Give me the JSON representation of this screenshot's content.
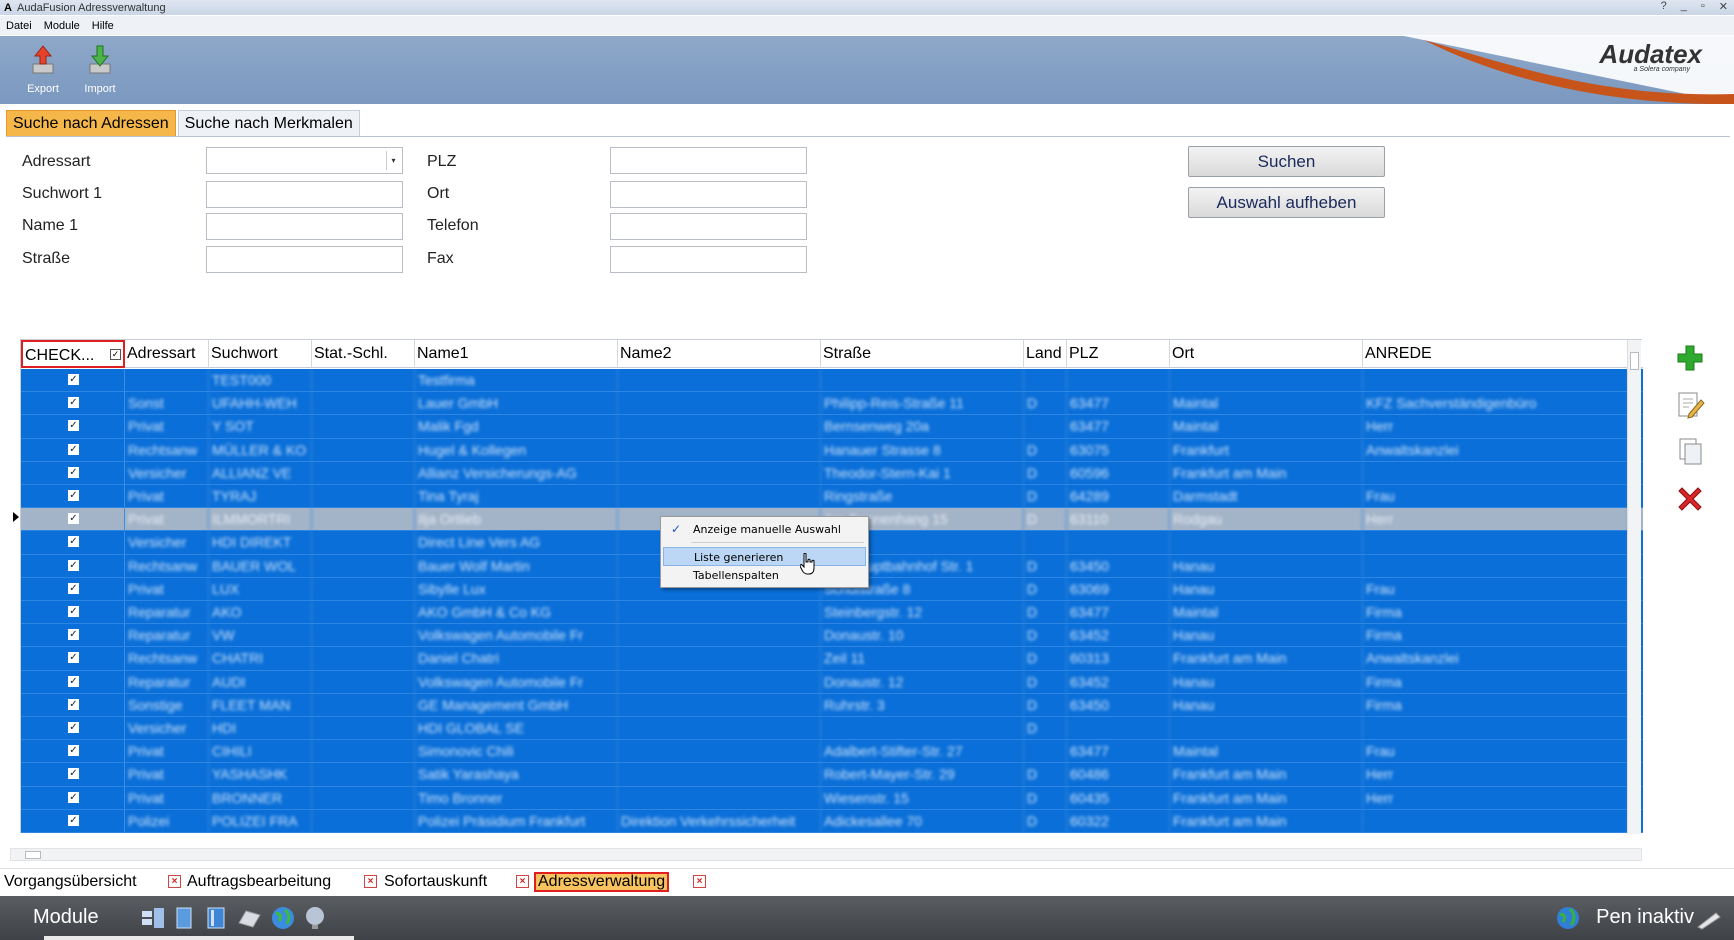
{
  "window": {
    "title": "AudaFusion Adressverwaltung",
    "controls": [
      "?",
      "_",
      "▫",
      "✕"
    ]
  },
  "menu": [
    "Datei",
    "Module",
    "Hilfe"
  ],
  "toolbar": {
    "export": "Export",
    "import": "Import"
  },
  "brand": {
    "name": "Audatex",
    "tagline": "a Solera company",
    "accent": "#c7541b"
  },
  "search_tabs": [
    "Suche nach Adressen",
    "Suche nach Merkmalen"
  ],
  "form": {
    "adressart": {
      "label": "Adressart",
      "value": ""
    },
    "suchwort1": {
      "label": "Suchwort 1",
      "value": ""
    },
    "name1": {
      "label": "Name 1",
      "value": ""
    },
    "strasse": {
      "label": "Straße",
      "value": ""
    },
    "plz": {
      "label": "PLZ",
      "value": ""
    },
    "ort": {
      "label": "Ort",
      "value": ""
    },
    "telefon": {
      "label": "Telefon",
      "value": ""
    },
    "fax": {
      "label": "Fax",
      "value": ""
    }
  },
  "buttons": {
    "search": "Suchen",
    "clear": "Auswahl aufheben"
  },
  "grid": {
    "columns": [
      "CHECK...",
      "Adressart",
      "Suchwort",
      "Stat.-Schl.",
      "Name1",
      "Name2",
      "Straße",
      "Land",
      "PLZ",
      "Ort",
      "ANREDE"
    ],
    "rows": [
      [
        "✓",
        "",
        "TEST000",
        "",
        "Testfirma",
        "",
        "",
        "",
        "",
        "",
        ""
      ],
      [
        "✓",
        "Sonst",
        "UFAHH-WEH",
        "",
        "Lauer GmbH",
        "",
        "Philipp-Reis-Straße 11",
        "D",
        "63477",
        "Maintal",
        "KFZ Sachverständigenbüro"
      ],
      [
        "✓",
        "Privat",
        "Y SOT",
        "",
        "Malik Fgd",
        "",
        "Bernsenweg 20a",
        "",
        "63477",
        "Maintal",
        "Herr"
      ],
      [
        "✓",
        "Rechtsanw",
        "MÜLLER & KO",
        "",
        "Hugel & Kollegen",
        "",
        "Hanauer Strasse 8",
        "D",
        "63075",
        "Frankfurt",
        "Anwaltskanzlei"
      ],
      [
        "✓",
        "Versicher",
        "ALLIANZ VE",
        "",
        "Allianz Versicherungs-AG",
        "",
        "Theodor-Stern-Kai 1",
        "D",
        "60596",
        "Frankfurt am Main",
        ""
      ],
      [
        "✓",
        "Privat",
        "TYRAJ",
        "",
        "Tina Tyraj",
        "",
        "Ringstraße",
        "D",
        "64289",
        "Darmstadt",
        "Frau"
      ],
      [
        "✓",
        "Privat",
        "ILMMORTRI",
        "",
        "Ilja Ortlieb",
        "",
        "Am Sonnenhang 15",
        "D",
        "63110",
        "Rodgau",
        "Herr"
      ],
      [
        "✓",
        "Versicher",
        "HDI DIREKT",
        "",
        "Direct Line Vers AG",
        "",
        "",
        "",
        "",
        "",
        ""
      ],
      [
        "✓",
        "Rechtsanw",
        "BAUER WOL",
        "",
        "Bauer Wolf Martin",
        "",
        "Am Hauptbahnhof Str. 1",
        "D",
        "63450",
        "Hanau",
        ""
      ],
      [
        "✓",
        "Privat",
        "LUX",
        "",
        "Sibylle Lux",
        "",
        "Schulstraße 8",
        "D",
        "63069",
        "Hanau",
        "Frau"
      ],
      [
        "✓",
        "Reparatur",
        "AKO",
        "",
        "AKO GmbH & Co KG",
        "",
        "Steinbergstr. 12",
        "D",
        "63477",
        "Maintal",
        "Firma"
      ],
      [
        "✓",
        "Reparatur",
        "VW",
        "",
        "Volkswagen Automobile Fr",
        "",
        "Donaustr. 10",
        "D",
        "63452",
        "Hanau",
        "Firma"
      ],
      [
        "✓",
        "Rechtsanw",
        "CHATRI",
        "",
        "Daniel Chatri",
        "",
        "Zeil 11",
        "D",
        "60313",
        "Frankfurt am Main",
        "Anwaltskanzlei"
      ],
      [
        "✓",
        "Reparatur",
        "AUDI",
        "",
        "Volkswagen Automobile Fr",
        "",
        "Donaustr. 12",
        "D",
        "63452",
        "Hanau",
        "Firma"
      ],
      [
        "✓",
        "Sonstige",
        "FLEET MAN",
        "",
        "GE Management GmbH",
        "",
        "Ruhrstr. 3",
        "D",
        "63450",
        "Hanau",
        "Firma"
      ],
      [
        "✓",
        "Versicher",
        "HDI",
        "",
        "HDI GLOBAL SE",
        "",
        "",
        "D",
        "",
        "",
        ""
      ],
      [
        "✓",
        "Privat",
        "CIHILI",
        "",
        "Simonovic Chili",
        "",
        "Adalbert-Stifter-Str. 27",
        "",
        "63477",
        "Maintal",
        "Frau"
      ],
      [
        "✓",
        "Privat",
        "YASHASHK",
        "",
        "Satik Yarashaya",
        "",
        "Robert-Mayer-Str. 29",
        "D",
        "60486",
        "Frankfurt am Main",
        "Herr"
      ],
      [
        "✓",
        "Privat",
        "BRONNER",
        "",
        "Timo Bronner",
        "",
        "Wiesenstr. 15",
        "D",
        "60435",
        "Frankfurt am Main",
        "Herr"
      ],
      [
        "✓",
        "Polizei",
        "POLIZEI FRA",
        "",
        "Polizei Präsidium Frankfurt",
        "Direktion Verkehrssicherheit",
        "Adickesallee 70",
        "D",
        "60322",
        "Frankfurt am Main",
        ""
      ]
    ],
    "selected_row": 6
  },
  "context_menu": {
    "items": [
      {
        "label": "Anzeige manuelle Auswahl",
        "checked": true
      },
      {
        "label": "Liste generieren",
        "highlighted": true
      },
      {
        "label": "Tabellenspalten"
      }
    ]
  },
  "doc_tabs": [
    "Vorgangsübersicht",
    "Auftragsbearbeitung",
    "Sofortauskunft",
    "Adressverwaltung"
  ],
  "taskbar": {
    "module": "Module",
    "pen_status": "Pen inaktiv"
  }
}
